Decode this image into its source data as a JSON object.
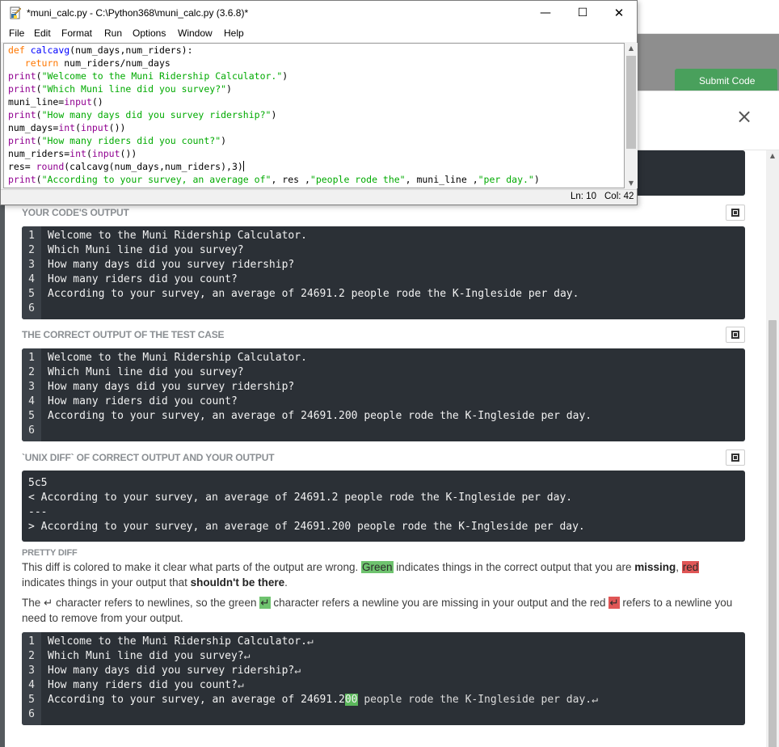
{
  "background_page": {
    "submit_button_label": "Submit Code",
    "modal_close": "×"
  },
  "idle_window": {
    "title": "*muni_calc.py - C:\\Python368\\muni_calc.py (3.6.8)*",
    "controls": {
      "minimize": "—",
      "maximize": "☐",
      "close": "✕"
    },
    "menu": [
      "File",
      "Edit",
      "Format",
      "Run",
      "Options",
      "Window",
      "Help"
    ],
    "status": {
      "line": "Ln: 10",
      "col": "Col: 42"
    }
  },
  "modal": {
    "partial_top_text": "",
    "your_output": {
      "title": "YOUR CODE'S OUTPUT",
      "lines": [
        "Welcome to the Muni Ridership Calculator.",
        "Which Muni line did you survey?",
        "How many days did you survey ridership?",
        "How many riders did you count?",
        "According to your survey, an average of 24691.2 people rode the K-Ingleside per day.",
        ""
      ]
    },
    "correct_output": {
      "title": "THE CORRECT OUTPUT OF THE TEST CASE",
      "lines": [
        "Welcome to the Muni Ridership Calculator.",
        "Which Muni line did you survey?",
        "How many days did you survey ridership?",
        "How many riders did you count?",
        "According to your survey, an average of 24691.200 people rode the K-Ingleside per day.",
        ""
      ]
    },
    "unix_diff": {
      "title": "`UNIX DIFF` OF CORRECT OUTPUT AND YOUR OUTPUT",
      "lines": [
        "5c5",
        "< According to your survey, an average of 24691.2 people rode the K-Ingleside per day.",
        "---",
        "> According to your survey, an average of 24691.200 people rode the K-Ingleside per day."
      ]
    },
    "pretty_diff": {
      "title": "PRETTY DIFF",
      "para1": {
        "a": "This diff is colored to make it clear what parts of the output are wrong.",
        "green_word": "Green",
        "b": "indicates things in the correct output that you are",
        "missing": "missing",
        "c": ",",
        "red_word": "red",
        "d": "indicates things in your output that",
        "shouldnt": "shouldn't be there",
        "e": "."
      },
      "para2": {
        "a": "The ↵ character refers to newlines, so the green",
        "green_glyph": "↵",
        "b": "character refers a newline you are missing in your output and the red",
        "red_glyph": "↵",
        "c": "refers to a newline you need to remove from your output."
      },
      "lines": [
        {
          "pre": "Welcome to the Muni Ridership Calculator.",
          "hl": "",
          "post": "↵"
        },
        {
          "pre": "Which Muni line did you survey?",
          "hl": "",
          "post": "↵"
        },
        {
          "pre": "How many days did you survey ridership?",
          "hl": "",
          "post": "↵"
        },
        {
          "pre": "How many riders did you count?",
          "hl": "",
          "post": "↵"
        },
        {
          "pre": "According to your survey, an average of 24691.2",
          "hl": "00",
          "post": " people rode the K-Ingleside per day.↵"
        },
        {
          "pre": "",
          "hl": "",
          "post": ""
        }
      ]
    }
  },
  "code": [
    [
      {
        "t": "def ",
        "c": "kw"
      },
      {
        "t": "calcavg",
        "c": "fn"
      },
      {
        "t": "(num_days,num_riders):",
        "c": ""
      }
    ],
    [
      {
        "t": "   ",
        "c": ""
      },
      {
        "t": "return",
        "c": "kw"
      },
      {
        "t": " num_riders/num_days",
        "c": ""
      }
    ],
    [
      {
        "t": "print",
        "c": "bi"
      },
      {
        "t": "(",
        "c": ""
      },
      {
        "t": "\"Welcome to the Muni Ridership Calculator.\"",
        "c": "st"
      },
      {
        "t": ")",
        "c": ""
      }
    ],
    [
      {
        "t": "print",
        "c": "bi"
      },
      {
        "t": "(",
        "c": ""
      },
      {
        "t": "\"Which Muni line did you survey?\"",
        "c": "st"
      },
      {
        "t": ")",
        "c": ""
      }
    ],
    [
      {
        "t": "muni_line=",
        "c": ""
      },
      {
        "t": "input",
        "c": "bi"
      },
      {
        "t": "()",
        "c": ""
      }
    ],
    [
      {
        "t": "print",
        "c": "bi"
      },
      {
        "t": "(",
        "c": ""
      },
      {
        "t": "\"How many days did you survey ridership?\"",
        "c": "st"
      },
      {
        "t": ")",
        "c": ""
      }
    ],
    [
      {
        "t": "num_days=",
        "c": ""
      },
      {
        "t": "int",
        "c": "bi"
      },
      {
        "t": "(",
        "c": ""
      },
      {
        "t": "input",
        "c": "bi"
      },
      {
        "t": "())",
        "c": ""
      }
    ],
    [
      {
        "t": "print",
        "c": "bi"
      },
      {
        "t": "(",
        "c": ""
      },
      {
        "t": "\"How many riders did you count?\"",
        "c": "st"
      },
      {
        "t": ")",
        "c": ""
      }
    ],
    [
      {
        "t": "num_riders=",
        "c": ""
      },
      {
        "t": "int",
        "c": "bi"
      },
      {
        "t": "(",
        "c": ""
      },
      {
        "t": "input",
        "c": "bi"
      },
      {
        "t": "())",
        "c": ""
      }
    ],
    [
      {
        "t": "res= ",
        "c": ""
      },
      {
        "t": "round",
        "c": "bi"
      },
      {
        "t": "(calcavg(num_days,num_riders),3)",
        "c": ""
      }
    ],
    [
      {
        "t": "print",
        "c": "bi"
      },
      {
        "t": "(",
        "c": ""
      },
      {
        "t": "\"According to your survey, an average of\"",
        "c": "st"
      },
      {
        "t": ", res ,",
        "c": ""
      },
      {
        "t": "\"people rode the\"",
        "c": "st"
      },
      {
        "t": ", muni_line ,",
        "c": ""
      },
      {
        "t": "\"per day.\"",
        "c": "st"
      },
      {
        "t": ")",
        "c": ""
      }
    ]
  ],
  "colors": {
    "panel_bg": "#2b3036",
    "gutter_bg": "#3a4047",
    "diff_green": "#5cb85c",
    "diff_red": "#e05656",
    "idle_keyword": "#ff7700",
    "idle_string": "#00aa00",
    "idle_builtin": "#900090",
    "idle_defname": "#0000ff"
  }
}
